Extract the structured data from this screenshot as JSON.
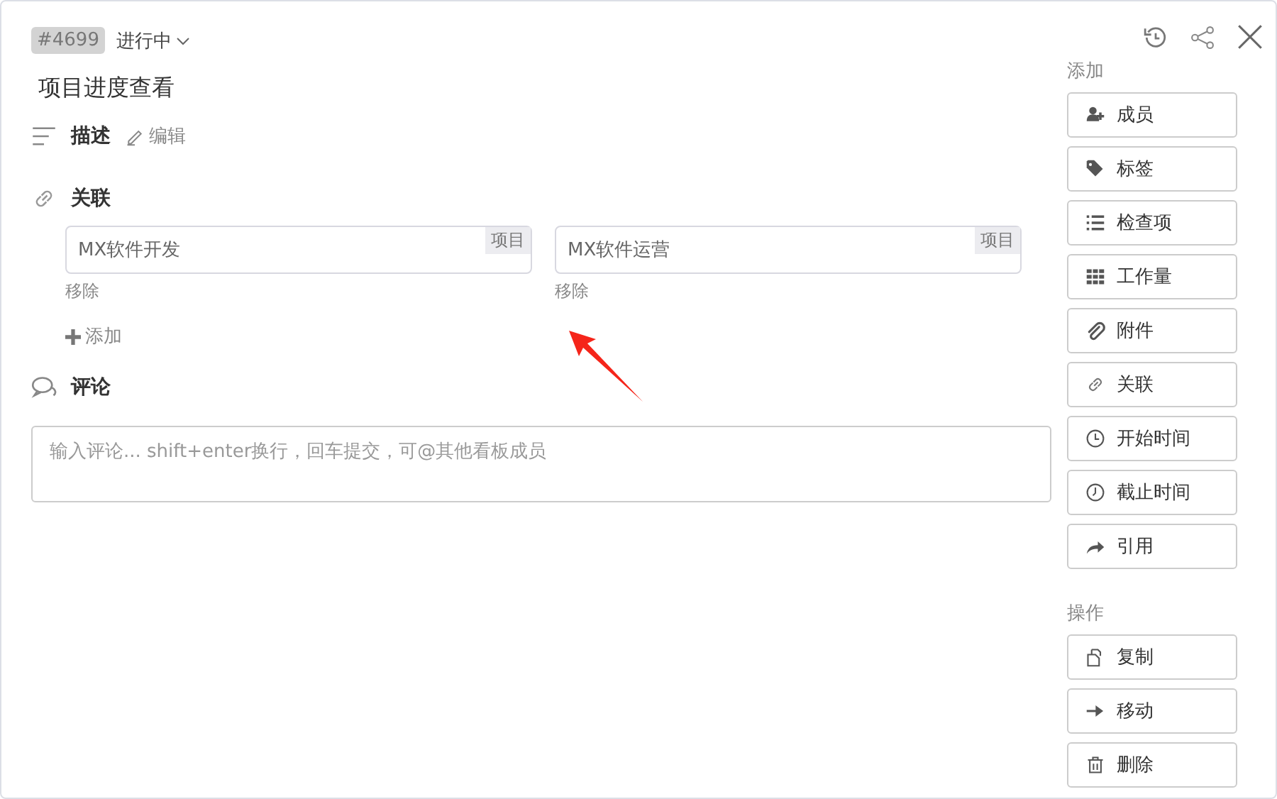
{
  "header": {
    "number": "#4699",
    "status": "进行中"
  },
  "title": "项目进度查看",
  "description": {
    "heading": "描述",
    "edit": "编辑"
  },
  "links": {
    "heading": "关联",
    "items": [
      {
        "name": "MX软件开发",
        "tag": "项目",
        "remove": "移除"
      },
      {
        "name": "MX软件运营",
        "tag": "项目",
        "remove": "移除"
      }
    ],
    "add": "添加"
  },
  "comments": {
    "heading": "评论",
    "placeholder": "输入评论... shift+enter换行，回车提交，可@其他看板成员"
  },
  "sidebar": [
    {
      "heading": "添加",
      "buttons": [
        "成员",
        "标签",
        "检查项",
        "工作量",
        "附件",
        "关联",
        "开始时间",
        "截止时间",
        "引用"
      ]
    },
    {
      "heading": "操作",
      "buttons": [
        "复制",
        "移动",
        "删除"
      ]
    }
  ]
}
